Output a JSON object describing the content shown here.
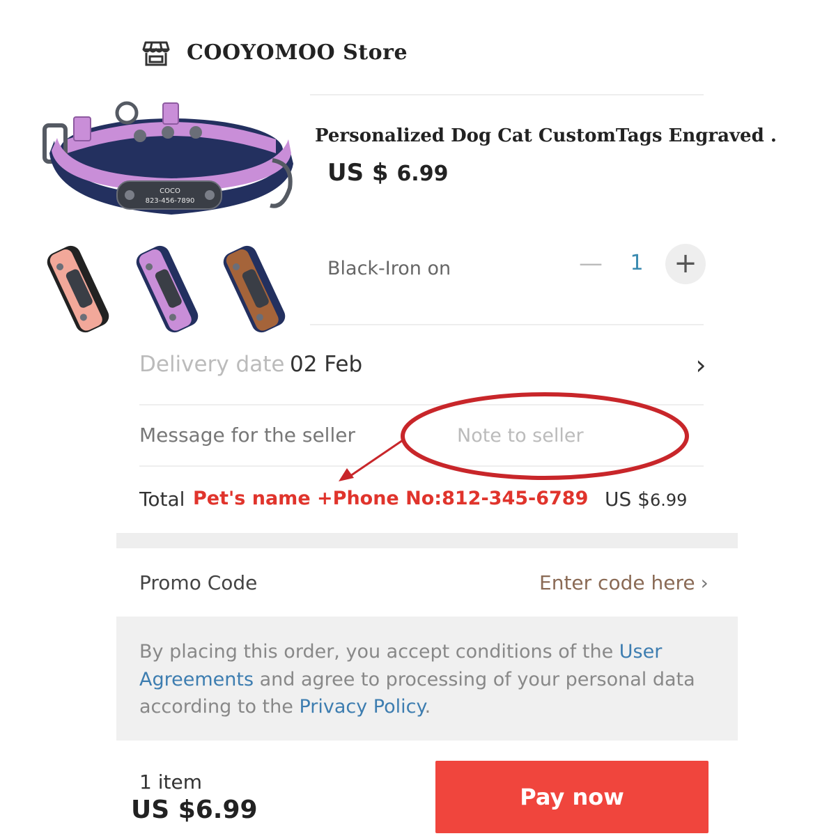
{
  "store": {
    "icon": "store-icon",
    "name": "COOYOMOO  Store"
  },
  "product": {
    "title": "Personalized Dog Cat CustomTags Engraved .",
    "price_currency": "US $",
    "price_amount": "6.99",
    "main_image": {
      "tag_name": "COCO",
      "tag_phone": "823-456-7890",
      "colors": {
        "strap": "#c98ed8",
        "lining": "#23305f",
        "metal": "#555a63"
      }
    },
    "thumbnails": [
      {
        "strap": "#f2a89a",
        "lining": "#222222"
      },
      {
        "strap": "#c98ed8",
        "lining": "#23305f"
      },
      {
        "strap": "#a5643a",
        "lining": "#23305f"
      }
    ],
    "variant": "Black-Iron on",
    "quantity": {
      "minus": "—",
      "value": "1",
      "plus": "+"
    }
  },
  "delivery": {
    "label": "Delivery date",
    "value": "02 Feb",
    "chevron": "›"
  },
  "message": {
    "label": "Message for the seller",
    "placeholder": "Note to seller"
  },
  "total": {
    "label": "Total",
    "annotation": "Pet's name +Phone No:812-345-6789",
    "currency": "US $",
    "amount": "6.99"
  },
  "promo": {
    "label": "Promo Code",
    "link": "Enter code here",
    "chevron": "›"
  },
  "agreement": {
    "part1": "By placing this order, you accept conditions of the ",
    "link1": "User Agreements",
    "part2": " and agree to processing of your personal data according to the ",
    "link2": "Privacy Policy",
    "part3": "."
  },
  "footer": {
    "items": "1 item",
    "price_currency": "US $",
    "price_amount": "6.99",
    "pay_label": "Pay now"
  },
  "colors": {
    "accent_red": "#f0453d",
    "annotation_red": "#e0342c",
    "link_blue": "#3d7db0"
  }
}
